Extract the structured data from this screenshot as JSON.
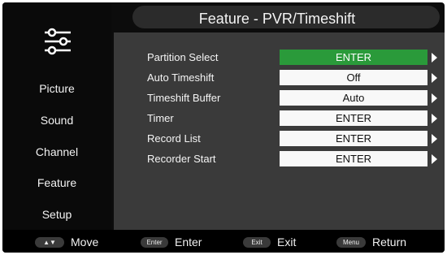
{
  "header": {
    "title": "Feature - PVR/Timeshift"
  },
  "sidebar": {
    "icon": "settings-sliders-icon",
    "items": [
      {
        "label": "Picture"
      },
      {
        "label": "Sound"
      },
      {
        "label": "Channel"
      },
      {
        "label": "Feature"
      },
      {
        "label": "Setup"
      }
    ]
  },
  "settings": [
    {
      "label": "Partition Select",
      "value": "ENTER",
      "selected": true
    },
    {
      "label": "Auto Timeshift",
      "value": "Off",
      "selected": false
    },
    {
      "label": "Timeshift Buffer",
      "value": "Auto",
      "selected": false
    },
    {
      "label": "Timer",
      "value": "ENTER",
      "selected": false
    },
    {
      "label": "Record List",
      "value": "ENTER",
      "selected": false
    },
    {
      "label": "Recorder Start",
      "value": "ENTER",
      "selected": false
    }
  ],
  "footer": {
    "move": {
      "key": "▲▼",
      "label": "Move"
    },
    "enter": {
      "key": "Enter",
      "label": "Enter"
    },
    "exit": {
      "key": "Exit",
      "label": "Exit"
    },
    "return": {
      "key": "Menu",
      "label": "Return"
    }
  },
  "colors": {
    "selected_value_bg": "#2a9a3a",
    "value_bg": "#f8f8f8",
    "panel_bg": "#3a3a3a",
    "sidebar_bg": "#0a0a0a"
  }
}
